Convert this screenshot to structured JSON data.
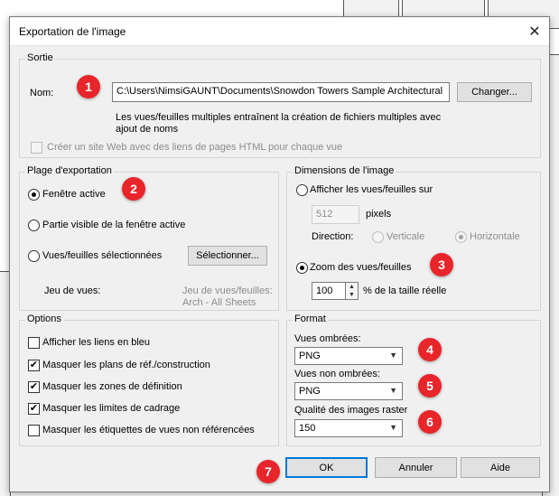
{
  "dialog": {
    "title": "Exportation de l'image",
    "close_label": "✕"
  },
  "sortie": {
    "legend": "Sortie",
    "name_label": "Nom:",
    "name_value": "C:\\Users\\NimsiGAUNT\\Documents\\Snowdon Towers Sample Architectural",
    "change_button": "Changer...",
    "note_line1": "Les vues/feuilles multiples entraînent la création de fichiers multiples avec",
    "note_line2": "ajout de noms",
    "web_checkbox_label": "Créer un site Web avec des liens de pages HTML pour chaque vue"
  },
  "range": {
    "legend": "Plage d'exportation",
    "active_window": "Fenêtre active",
    "visible_part": "Partie visible de la fenêtre active",
    "selected_views": "Vues/feuilles sélectionnées",
    "select_button": "Sélectionner...",
    "view_set_label": "Jeu de vues:",
    "view_set_line1": "Jeu de vues/feuilles:",
    "view_set_line2": "Arch - All Sheets"
  },
  "dimensions": {
    "legend": "Dimensions de l'image",
    "fit_label": "Afficher les vues/feuilles sur",
    "pixels_value": "512",
    "pixels_label": "pixels",
    "direction_label": "Direction:",
    "vertical": "Verticale",
    "horizontal": "Horizontale",
    "zoom_label": "Zoom des vues/feuilles",
    "zoom_value": "100",
    "zoom_suffix": "% de la taille réelle"
  },
  "options": {
    "legend": "Options",
    "items": [
      {
        "label": "Afficher les liens en bleu",
        "checked": false
      },
      {
        "label": "Masquer les plans de réf./construction",
        "checked": true
      },
      {
        "label": "Masquer les zones de définition",
        "checked": true
      },
      {
        "label": "Masquer les limites de cadrage",
        "checked": true
      },
      {
        "label": "Masquer les étiquettes de vues non référencées",
        "checked": false
      }
    ]
  },
  "format": {
    "legend": "Format",
    "shaded_label": "Vues ombrées:",
    "shaded_value": "PNG",
    "unshaded_label": "Vues non ombrées:",
    "unshaded_value": "PNG",
    "quality_label": "Qualité des images raster",
    "quality_value": "150"
  },
  "buttons": {
    "ok": "OK",
    "cancel": "Annuler",
    "help": "Aide"
  },
  "markers": [
    "1",
    "2",
    "3",
    "4",
    "5",
    "6",
    "7"
  ],
  "colors": {
    "marker": "#e8252a",
    "default_button_border": "#0078d7"
  }
}
